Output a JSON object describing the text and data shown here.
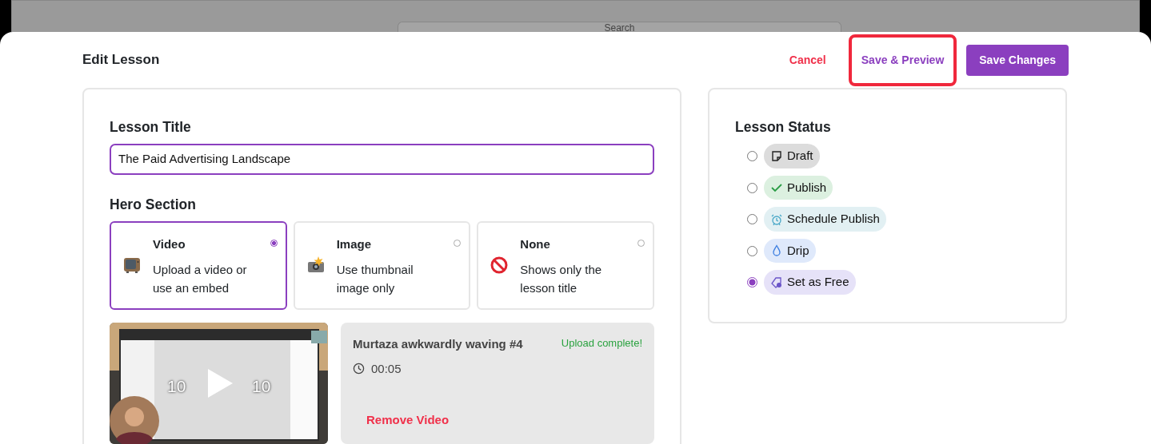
{
  "backdrop": {
    "search_placeholder": "Search"
  },
  "header": {
    "title": "Edit Lesson",
    "buttons": [
      {
        "label": "Cancel",
        "kind": "cancel",
        "highlighted": false
      },
      {
        "label": "Save & Preview",
        "kind": "secondary",
        "highlighted": true
      },
      {
        "label": "Save Changes",
        "kind": "primary",
        "highlighted": false
      }
    ]
  },
  "lesson_title": {
    "label": "Lesson Title",
    "value": "The Paid Advertising Landscape"
  },
  "hero_section": {
    "label": "Hero Section",
    "options": [
      {
        "title": "Video",
        "description": "Upload a video or use an embed",
        "selected": true
      },
      {
        "title": "Image",
        "description": "Use thumbnail image only",
        "selected": false
      },
      {
        "title": "None",
        "description": "Shows only the lesson title",
        "selected": false
      }
    ]
  },
  "video": {
    "player": {
      "skip_back": "10",
      "skip_forward": "10"
    },
    "name": "Murtaza awkwardly waving #4",
    "status": "Upload complete!",
    "duration": "00:05",
    "remove": "Remove Video"
  },
  "lesson_status": {
    "label": "Lesson Status",
    "options": [
      {
        "label": "Draft",
        "color": "#dcdcdc",
        "selected": false
      },
      {
        "label": "Publish",
        "color": "#dcf0e0",
        "selected": false
      },
      {
        "label": "Schedule Publish",
        "color": "#e2f0f3",
        "selected": false
      },
      {
        "label": "Drip",
        "color": "#dfe9fb",
        "selected": false
      },
      {
        "label": "Set as Free",
        "color": "#e6e2f8",
        "selected": true
      }
    ]
  }
}
